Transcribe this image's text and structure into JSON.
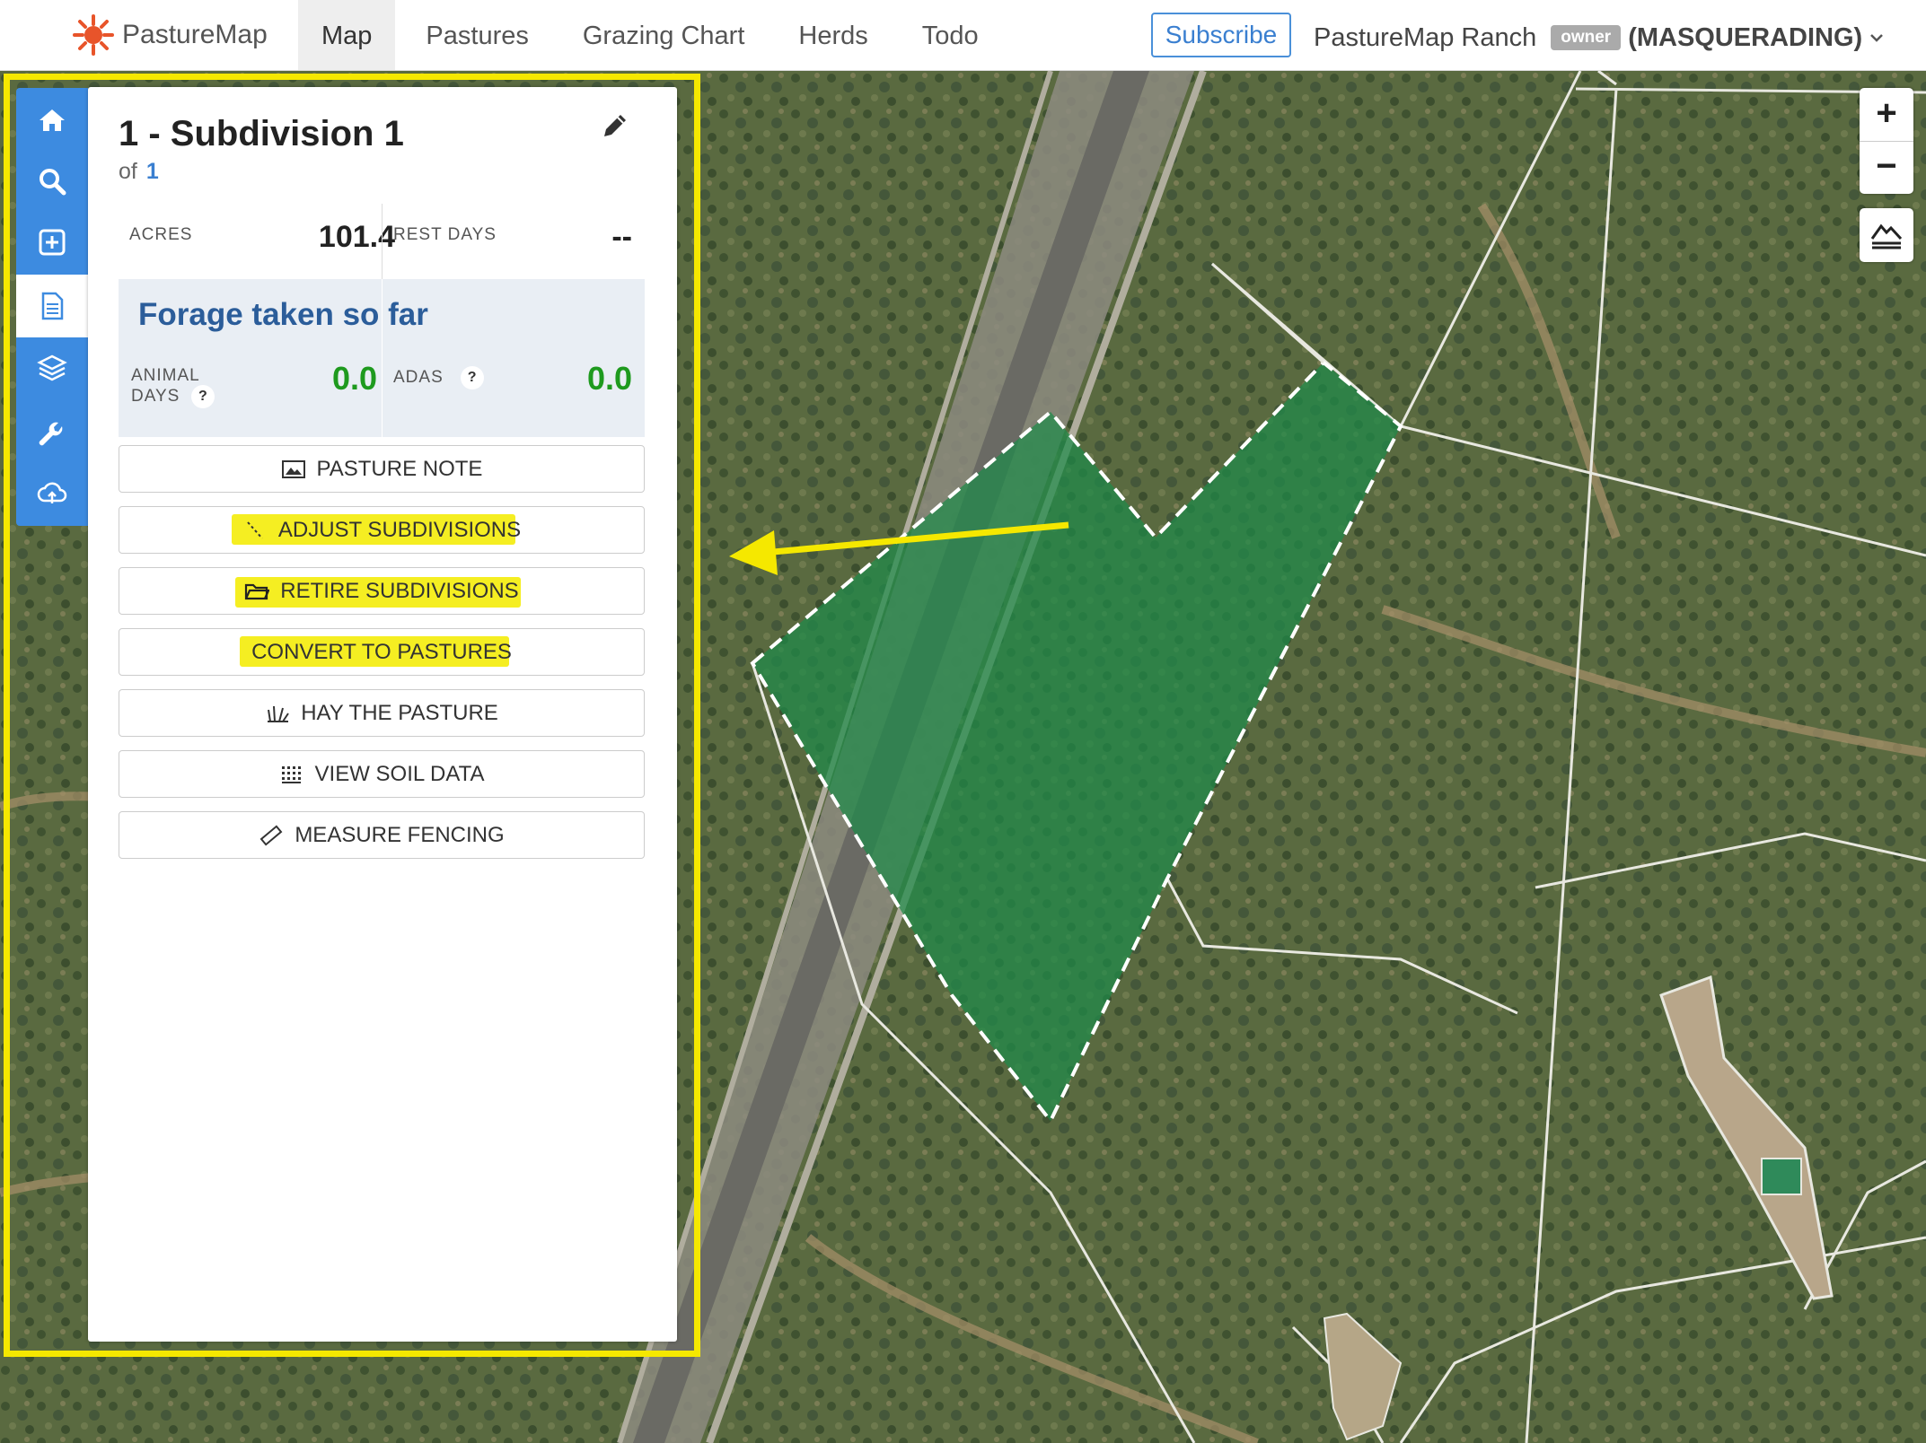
{
  "app": {
    "logo_text": "PastureMap"
  },
  "nav": {
    "items": [
      {
        "label": "Map",
        "active": true
      },
      {
        "label": "Pastures"
      },
      {
        "label": "Grazing Chart"
      },
      {
        "label": "Herds"
      },
      {
        "label": "Todo"
      }
    ],
    "subscribe_label": "Subscribe",
    "ranch_name": "PastureMap Ranch",
    "role_badge": "owner",
    "masquerade_label": "(MASQUERADING)"
  },
  "sidebar": {
    "icons": [
      "home-icon",
      "search-icon",
      "add-icon",
      "document-icon",
      "layers-icon",
      "wrench-icon",
      "cloud-upload-icon"
    ],
    "active_icon": "document-icon"
  },
  "panel": {
    "title": "1 - Subdivision 1",
    "of_label": "of",
    "of_count": "1",
    "acres_label": "ACRES",
    "acres_value": "101.4",
    "rest_days_label": "REST DAYS",
    "rest_days_value": "--",
    "forage": {
      "title": "Forage taken so far",
      "animal_days_label_1": "ANIMAL",
      "animal_days_label_2": "DAYS",
      "animal_days_value": "0.0",
      "adas_label": "ADAS",
      "adas_value": "0.0",
      "help_mark": "?"
    },
    "buttons": [
      {
        "label": "PASTURE NOTE",
        "icon": "image-icon"
      },
      {
        "label": "ADJUST SUBDIVISIONS",
        "icon": "line-icon",
        "highlighted": true
      },
      {
        "label": "RETIRE SUBDIVISIONS",
        "icon": "folder-icon",
        "highlighted": true
      },
      {
        "label": "CONVERT TO PASTURES",
        "icon": "",
        "highlighted": true
      },
      {
        "label": "HAY THE PASTURE",
        "icon": "grass-icon"
      },
      {
        "label": "VIEW SOIL DATA",
        "icon": "grid-icon"
      },
      {
        "label": "MEASURE FENCING",
        "icon": "ruler-icon"
      }
    ]
  },
  "map_controls": {
    "zoom_in": "+",
    "zoom_out": "−"
  },
  "colors": {
    "accent_blue": "#3d8be0",
    "highlight_yellow": "#f5e800",
    "forage_green": "#1e9a1e",
    "subdivision_fill": "#1f8a4a"
  }
}
